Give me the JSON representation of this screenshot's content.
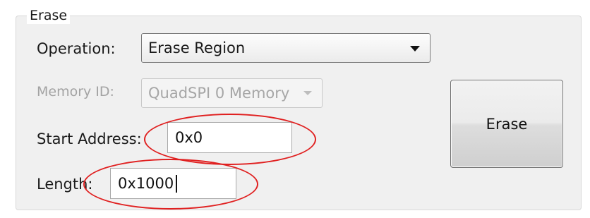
{
  "group": {
    "title": "Erase"
  },
  "operation": {
    "label": "Operation:",
    "value": "Erase Region",
    "arrow_icon": "dropdown-arrow-icon"
  },
  "memory_id": {
    "label": "Memory ID:",
    "value": "QuadSPI 0 Memory",
    "enabled": false,
    "arrow_icon": "dropdown-arrow-icon"
  },
  "start_address": {
    "label": "Start Address:",
    "value": "0x0"
  },
  "length": {
    "label": "Length:",
    "value": "0x1000"
  },
  "erase_button": {
    "label": "Erase"
  },
  "annotation": {
    "highlight_color": "#e02020",
    "highlighted_fields": [
      "start_address",
      "length"
    ]
  },
  "colors": {
    "panel_background": "#f0f0f0",
    "disabled_text": "#a3a3a3"
  }
}
